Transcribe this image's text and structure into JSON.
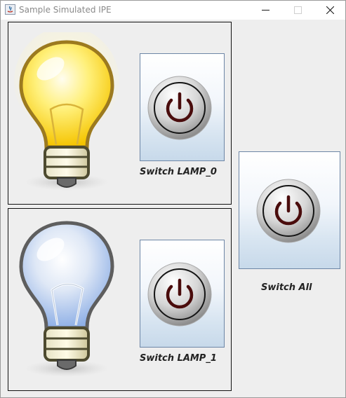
{
  "window": {
    "title": "Sample Simulated IPE",
    "minimize_icon": "minimize-icon",
    "maximize_icon": "maximize-icon",
    "close_icon": "close-icon"
  },
  "lamps": [
    {
      "name": "LAMP_0",
      "state": "on",
      "icon": "lightbulb-on-icon",
      "button_label": "Switch LAMP_0",
      "button_icon": "power-icon"
    },
    {
      "name": "LAMP_1",
      "state": "off",
      "icon": "lightbulb-off-icon",
      "button_label": "Switch LAMP_1",
      "button_icon": "power-icon"
    }
  ],
  "switch_all": {
    "button_label": "Switch All",
    "button_icon": "power-icon"
  },
  "colors": {
    "lamp_on": "#FFE23A",
    "lamp_off": "#9EB8E8",
    "power_symbol": "#4a0c0c"
  }
}
